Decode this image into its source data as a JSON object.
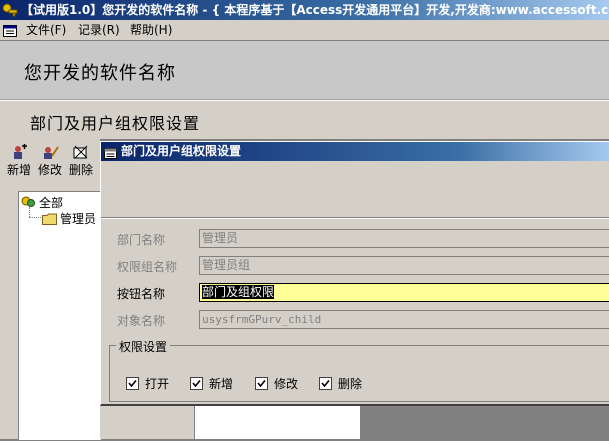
{
  "window": {
    "title": "【试用版1.0】您开发的软件名称 - { 本程序基于【Access开发通用平台】开发,开发商:www.accessoft.com"
  },
  "menubar": {
    "items": [
      "文件(F)",
      "记录(R)",
      "帮助(H)"
    ]
  },
  "header": {
    "software_name": "您开发的软件名称"
  },
  "subheader": {
    "title": "部门及用户组权限设置"
  },
  "toolbar": {
    "new_label": "新增",
    "edit_label": "修改",
    "delete_label": "删除"
  },
  "tree": {
    "root": "全部",
    "children": [
      "管理员"
    ]
  },
  "dialog": {
    "title": "部门及用户组权限设置",
    "fields": [
      {
        "label": "部门名称",
        "value": "管理员"
      },
      {
        "label": "权限组名称",
        "value": "管理员组"
      },
      {
        "label": "按钮名称",
        "value": "部门及组权限"
      },
      {
        "label": "对象名称",
        "value": "usysfrmGPurv_child"
      }
    ],
    "group": {
      "label": "权限设置",
      "checkboxes": [
        {
          "label": "打开",
          "checked": true
        },
        {
          "label": "新增",
          "checked": true
        },
        {
          "label": "修改",
          "checked": true
        },
        {
          "label": "删除",
          "checked": true
        }
      ]
    }
  },
  "colors": {
    "titlebar": "#0a246a",
    "face": "#d4d0c8",
    "active_field": "#ffff99"
  }
}
